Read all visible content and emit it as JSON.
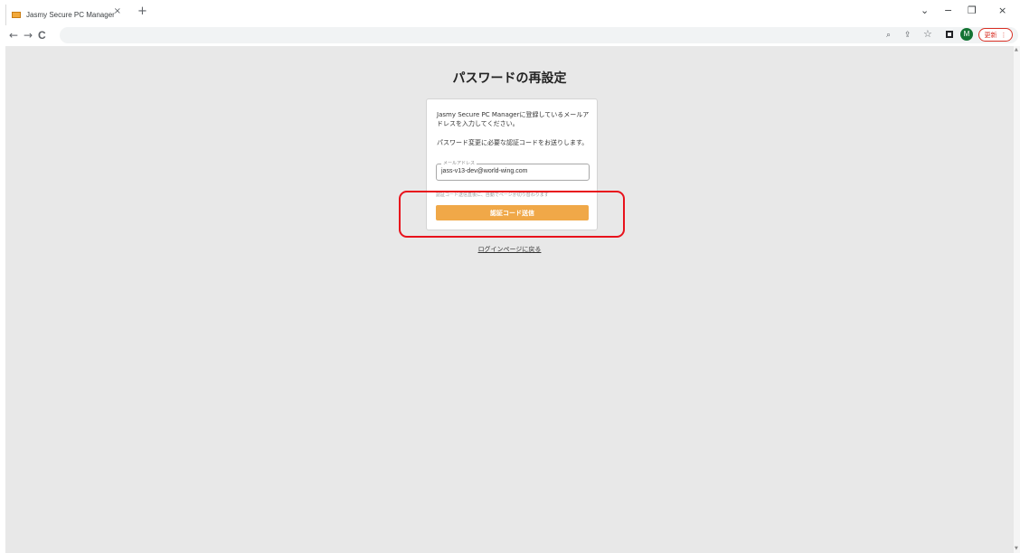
{
  "browser": {
    "tab": {
      "title": "Jasmy Secure PC Manager",
      "close_glyph": "×"
    },
    "new_tab_glyph": "+",
    "window_controls": {
      "menu_glyph": "⌄",
      "minimize_glyph": "−",
      "restore_glyph": "❐",
      "close_glyph": "×"
    },
    "nav": {
      "back_glyph": "←",
      "forward_glyph": "→",
      "reload_glyph": "C"
    },
    "toolbar_icons": {
      "zoom_glyph": "⌕",
      "share_glyph": "⇪",
      "star_glyph": "☆"
    },
    "profile_initial": "M",
    "update_button": {
      "label": "更新",
      "menu_glyph": "⋮"
    }
  },
  "page": {
    "title": "パスワードの再設定",
    "description_1": "Jasmy Secure PC Managerに登録しているメールアドレスを入力してください。",
    "description_2": "パスワード変更に必要な認証コードをお送りします。",
    "email_field": {
      "legend": "メールアドレス",
      "value": "jass-v13-dev@world-wing.com"
    },
    "note": "認証コード送信直後に、自動でページが切り替わります",
    "send_button_label": "認証コード送信",
    "login_link": "ログインページに戻る"
  },
  "colors": {
    "accent": "#f0a848",
    "highlight": "#e8121c",
    "background": "#e8e8e8",
    "avatar": "#137333"
  }
}
